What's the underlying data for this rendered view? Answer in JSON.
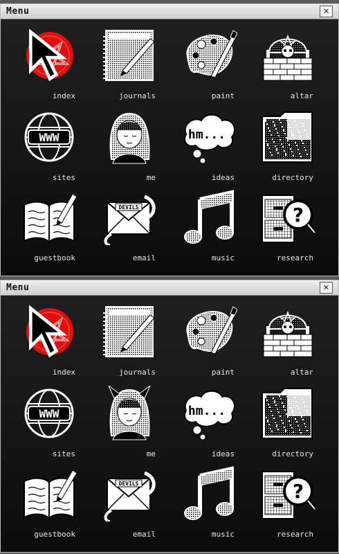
{
  "windows": [
    {
      "title": "Menu",
      "close_glyph": "✕",
      "items": [
        {
          "label": "index",
          "icon": "pentagram-icon"
        },
        {
          "label": "journals",
          "icon": "notebook-icon"
        },
        {
          "label": "paint",
          "icon": "palette-icon"
        },
        {
          "label": "altar",
          "icon": "altar-icon"
        },
        {
          "label": "sites",
          "icon": "globe-www-icon"
        },
        {
          "label": "me",
          "icon": "avatar-girl-icon"
        },
        {
          "label": "ideas",
          "icon": "thought-bubble-icon"
        },
        {
          "label": "directory",
          "icon": "folder-icon"
        },
        {
          "label": "guestbook",
          "icon": "open-book-icon"
        },
        {
          "label": "email",
          "icon": "envelope-icon"
        },
        {
          "label": "music",
          "icon": "music-note-icon"
        },
        {
          "label": "research",
          "icon": "file-cabinet-magnifier-icon"
        }
      ]
    },
    {
      "title": "Menu",
      "close_glyph": "✕",
      "items": [
        {
          "label": "index",
          "icon": "pentagram-icon"
        },
        {
          "label": "journals",
          "icon": "notebook-icon"
        },
        {
          "label": "paint",
          "icon": "palette-icon"
        },
        {
          "label": "altar",
          "icon": "altar-icon"
        },
        {
          "label": "sites",
          "icon": "globe-www-icon"
        },
        {
          "label": "me",
          "icon": "avatar-devil-girl-icon"
        },
        {
          "label": "ideas",
          "icon": "thought-bubble-icon"
        },
        {
          "label": "directory",
          "icon": "folder-icon"
        },
        {
          "label": "guestbook",
          "icon": "open-book-icon"
        },
        {
          "label": "email",
          "icon": "envelope-icon"
        },
        {
          "label": "music",
          "icon": "music-note-icon"
        },
        {
          "label": "research",
          "icon": "file-cabinet-magnifier-icon"
        }
      ]
    }
  ],
  "envelope_text": "DEVILS",
  "bubble_text": "hm...",
  "accent_red": "#e01010"
}
